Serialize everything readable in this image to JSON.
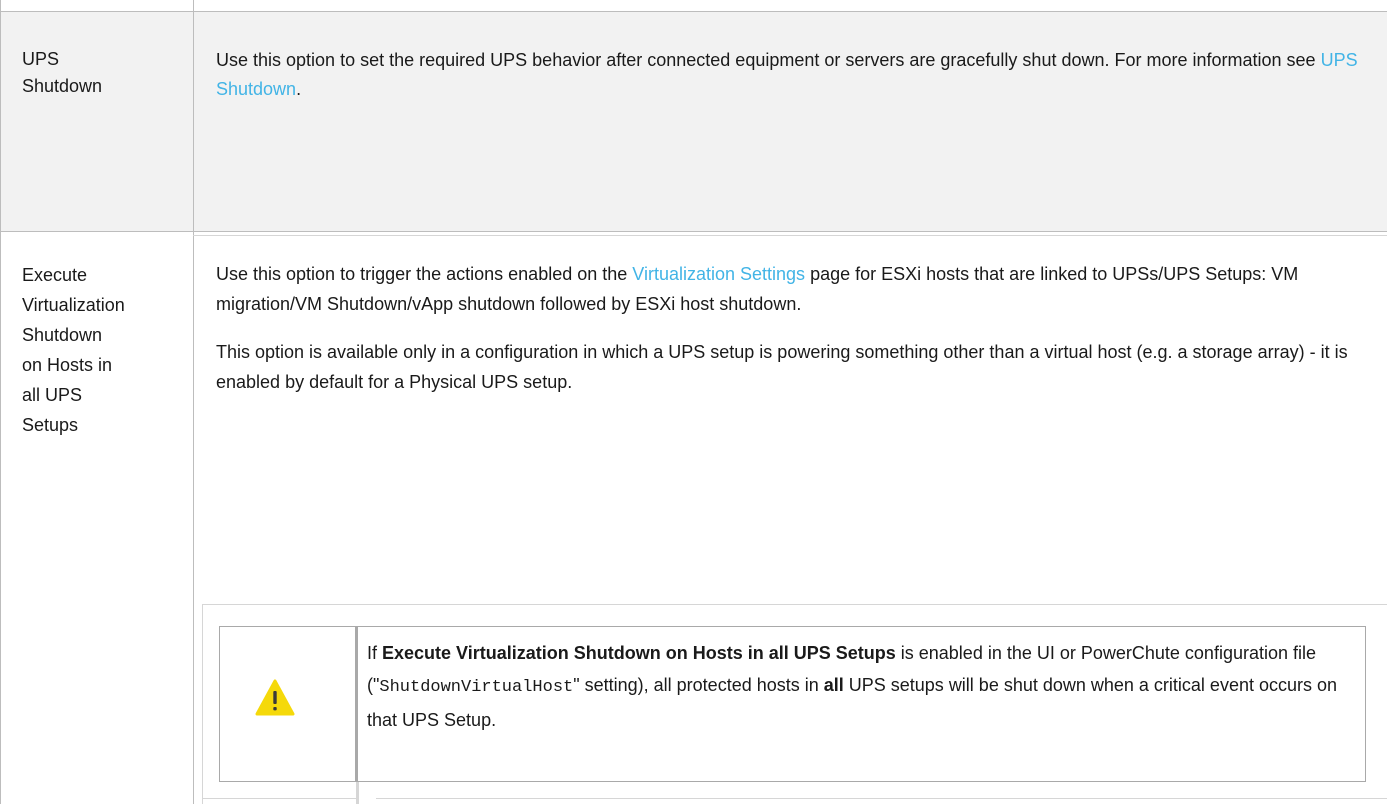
{
  "rows": [
    {
      "label_lines": [
        "UPS",
        "Shutdown"
      ],
      "body": {
        "text_before_link": "Use this option to set the required UPS behavior after connected equipment or servers are gracefully shut down. For more information see ",
        "link": "UPS Shutdown",
        "text_after_link": "."
      }
    },
    {
      "label_lines": [
        "Execute",
        "Virtualization",
        "Shutdown",
        "on Hosts in",
        "all UPS",
        "Setups"
      ],
      "para1": {
        "text_before_link": "Use this option to trigger the actions enabled on the ",
        "link": "Virtualization Settings",
        "text_after_link": " page for ESXi hosts that are linked to UPSs/UPS Setups: VM migration/VM Shutdown/vApp shutdown followed by ESXi host shutdown."
      },
      "para2": "This option is available only in a configuration in which a UPS setup is powering something other than a virtual host (e.g. a storage array) - it is enabled by default for a Physical UPS setup.",
      "note": {
        "icon": "warning-icon",
        "prefix": "If ",
        "bold_option": "Execute Virtualization Shutdown on Hosts in all UPS Setups",
        "mid1": " is enabled in the UI or PowerChute configuration file (",
        "quote_open": "\"",
        "code": "ShutdownVirtualHost",
        "quote_close": "\"",
        "mid2": " setting), all protected hosts in ",
        "bold_all": "all",
        "suffix": " UPS setups will be shut down when a critical event occurs on that UPS Setup."
      }
    }
  ],
  "colors": {
    "link": "#42b4e6",
    "row_shade": "#f2f2f2",
    "border": "#bdbdbd",
    "warning": "#f5d90a"
  }
}
